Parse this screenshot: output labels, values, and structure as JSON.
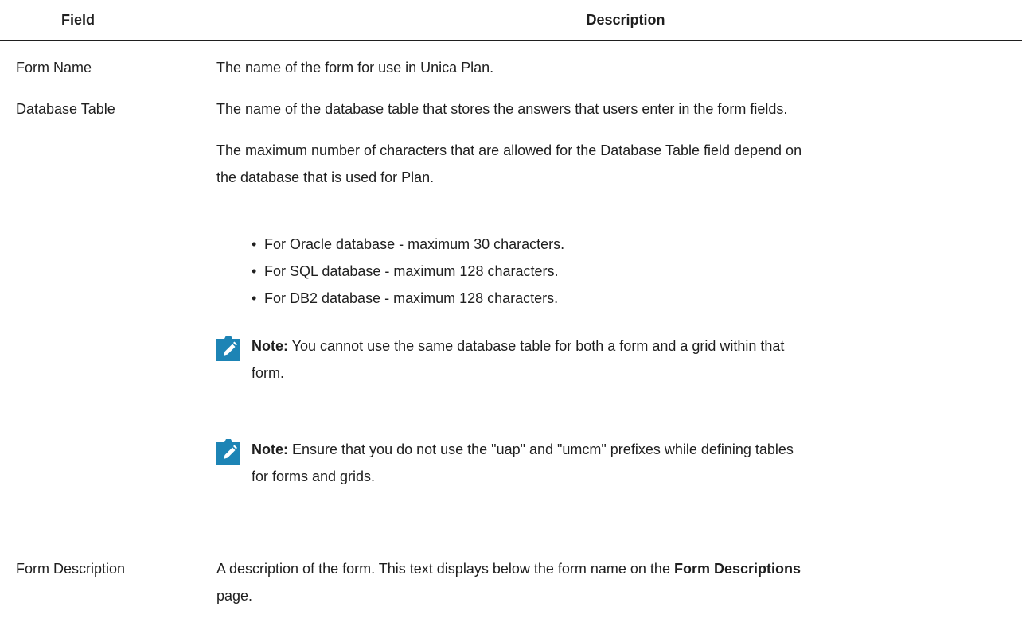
{
  "table": {
    "headers": {
      "field": "Field",
      "description": "Description"
    },
    "rows": {
      "form_name": {
        "field": "Form Name",
        "description": "The name of the form for use in Unica Plan."
      },
      "database_table": {
        "field": "Database Table",
        "description": "The name of the database table that stores the answers that users enter in the form fields.",
        "max_chars_line1": "The maximum number of characters that are allowed for the Database Table field depend on",
        "max_chars_line2": "the database that is used for Plan.",
        "bullets": [
          "For Oracle database - maximum 30 characters.",
          "For SQL database - maximum 128 characters.",
          "For DB2 database - maximum 128 characters."
        ],
        "notes": [
          {
            "label": "Note:",
            "line1": " You cannot use the same database table for both a form and a grid within that",
            "line2": "form."
          },
          {
            "label": "Note:",
            "line1": " Ensure that you do not use the \"uap\" and \"umcm\" prefixes while defining tables",
            "line2": "for forms and grids."
          }
        ]
      },
      "form_description": {
        "field": "Form Description",
        "desc_part1": "A description of the form. This text displays below the form name on the ",
        "desc_bold": "Form Descriptions",
        "desc_part2": "page."
      }
    }
  },
  "colors": {
    "note_icon": "#1d84b5",
    "text": "#1f1f1f"
  },
  "icons": {
    "note": "pencil-note-icon"
  }
}
